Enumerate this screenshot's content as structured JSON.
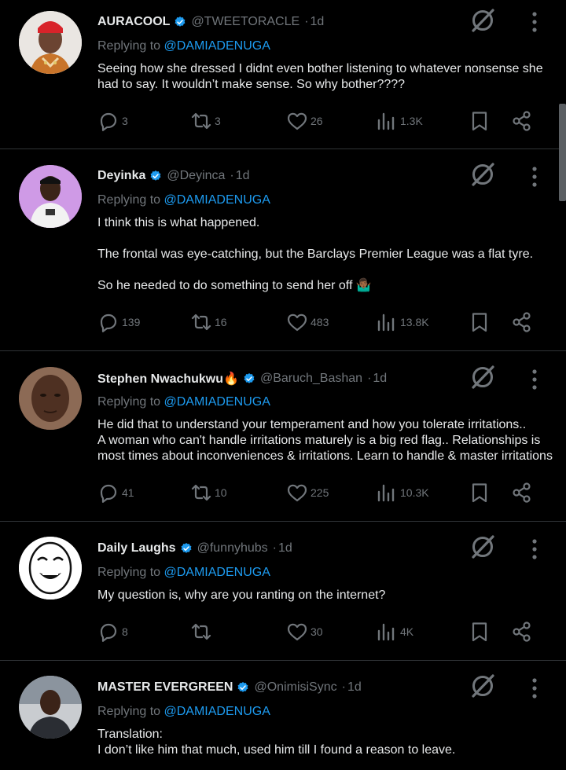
{
  "tweets": [
    {
      "name": "AURACOOL",
      "handle": "@TWEETORACLE",
      "time": "1d",
      "replying_label": "Replying to",
      "replying_to": "@DAMIADENUGA",
      "text": [
        "Seeing how she dressed I didnt even bother listening to whatever nonsense she had to say. It wouldn’t make sense. So why bother????"
      ],
      "replies": "3",
      "retweets": "3",
      "likes": "26",
      "views": "1.3K",
      "avatar_color": "#e9e5e1"
    },
    {
      "name": "Deyinka",
      "handle": "@Deyinca",
      "time": "1d",
      "replying_label": "Replying to",
      "replying_to": "@DAMIADENUGA",
      "text": [
        "I think this is what happened.",
        "The frontal was eye-catching, but the Barclays Premier League was a flat tyre.",
        "So he needed to do something to send her off 🤷🏾‍♂️"
      ],
      "replies": "139",
      "retweets": "16",
      "likes": "483",
      "views": "13.8K",
      "avatar_color": "#c98fe0"
    },
    {
      "name": "Stephen Nwachukwu🔥",
      "handle": "@Baruch_Bashan",
      "time": "1d",
      "replying_label": "Replying to",
      "replying_to": "@DAMIADENUGA",
      "text": [
        "He did that to understand your temperament and how you tolerate irritations..\nA woman who can't handle irritations maturely is a big red flag.. Relationships is most times about inconveniences & irritations. Learn to handle & master irritations"
      ],
      "replies": "41",
      "retweets": "10",
      "likes": "225",
      "views": "10.3K",
      "avatar_color": "#5a3b2c"
    },
    {
      "name": "Daily Laughs",
      "handle": "@funnyhubs",
      "time": "1d",
      "replying_label": "Replying to",
      "replying_to": "@DAMIADENUGA",
      "text": [
        "My question is, why are you ranting on the internet?"
      ],
      "replies": "8",
      "retweets": "",
      "likes": "30",
      "views": "4K",
      "avatar_color": "#ffffff"
    },
    {
      "name": "MASTER EVERGREEN",
      "handle": "@OnimisiSync",
      "time": "1d",
      "replying_label": "Replying to",
      "replying_to": "@DAMIADENUGA",
      "text": [
        "Translation:\nI don’t like him that much, used him till I found a reason to leave."
      ],
      "replies": "",
      "retweets": "",
      "likes": "",
      "views": "",
      "avatar_color": "#3a4048"
    }
  ],
  "colors": {
    "accent": "#1d9bf0",
    "muted": "#71767b",
    "text": "#e7e9ea",
    "divider": "#2f3336"
  },
  "icons": [
    "verified-badge-icon",
    "grok-icon",
    "more-icon",
    "reply-icon",
    "retweet-icon",
    "like-icon",
    "views-icon",
    "bookmark-icon",
    "share-icon"
  ]
}
